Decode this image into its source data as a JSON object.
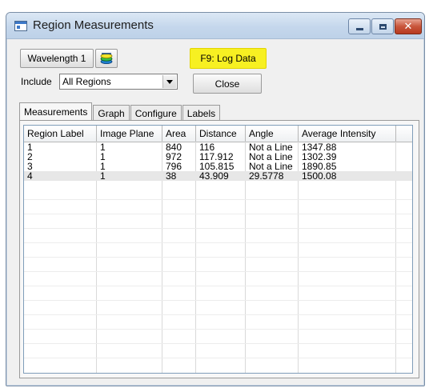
{
  "window": {
    "title": "Region Measurements"
  },
  "toolbar": {
    "wavelength_label": "Wavelength 1",
    "log_label": "F9: Log Data",
    "close_label": "Close",
    "include_label": "Include",
    "include_value": "All Regions"
  },
  "tabs": [
    {
      "label": "Measurements",
      "active": true
    },
    {
      "label": "Graph",
      "active": false
    },
    {
      "label": "Configure",
      "active": false
    },
    {
      "label": "Labels",
      "active": false
    }
  ],
  "table": {
    "columns": [
      "Region Label",
      "Image Plane",
      "Area",
      "Distance",
      "Angle",
      "Average Intensity"
    ],
    "rows": [
      [
        "1",
        "1",
        "840",
        "116",
        "Not a Line",
        "1347.88"
      ],
      [
        "2",
        "1",
        "972",
        "117.912",
        "Not a Line",
        "1302.39"
      ],
      [
        "3",
        "1",
        "796",
        "105.815",
        "Not a Line",
        "1890.85"
      ],
      [
        "4",
        "1",
        "38",
        "43.909",
        "29.5778",
        "1500.08"
      ]
    ],
    "selected_row": 3
  },
  "colors": {
    "log_button": "#f7f022",
    "selected_row": "#e7e7e7"
  }
}
